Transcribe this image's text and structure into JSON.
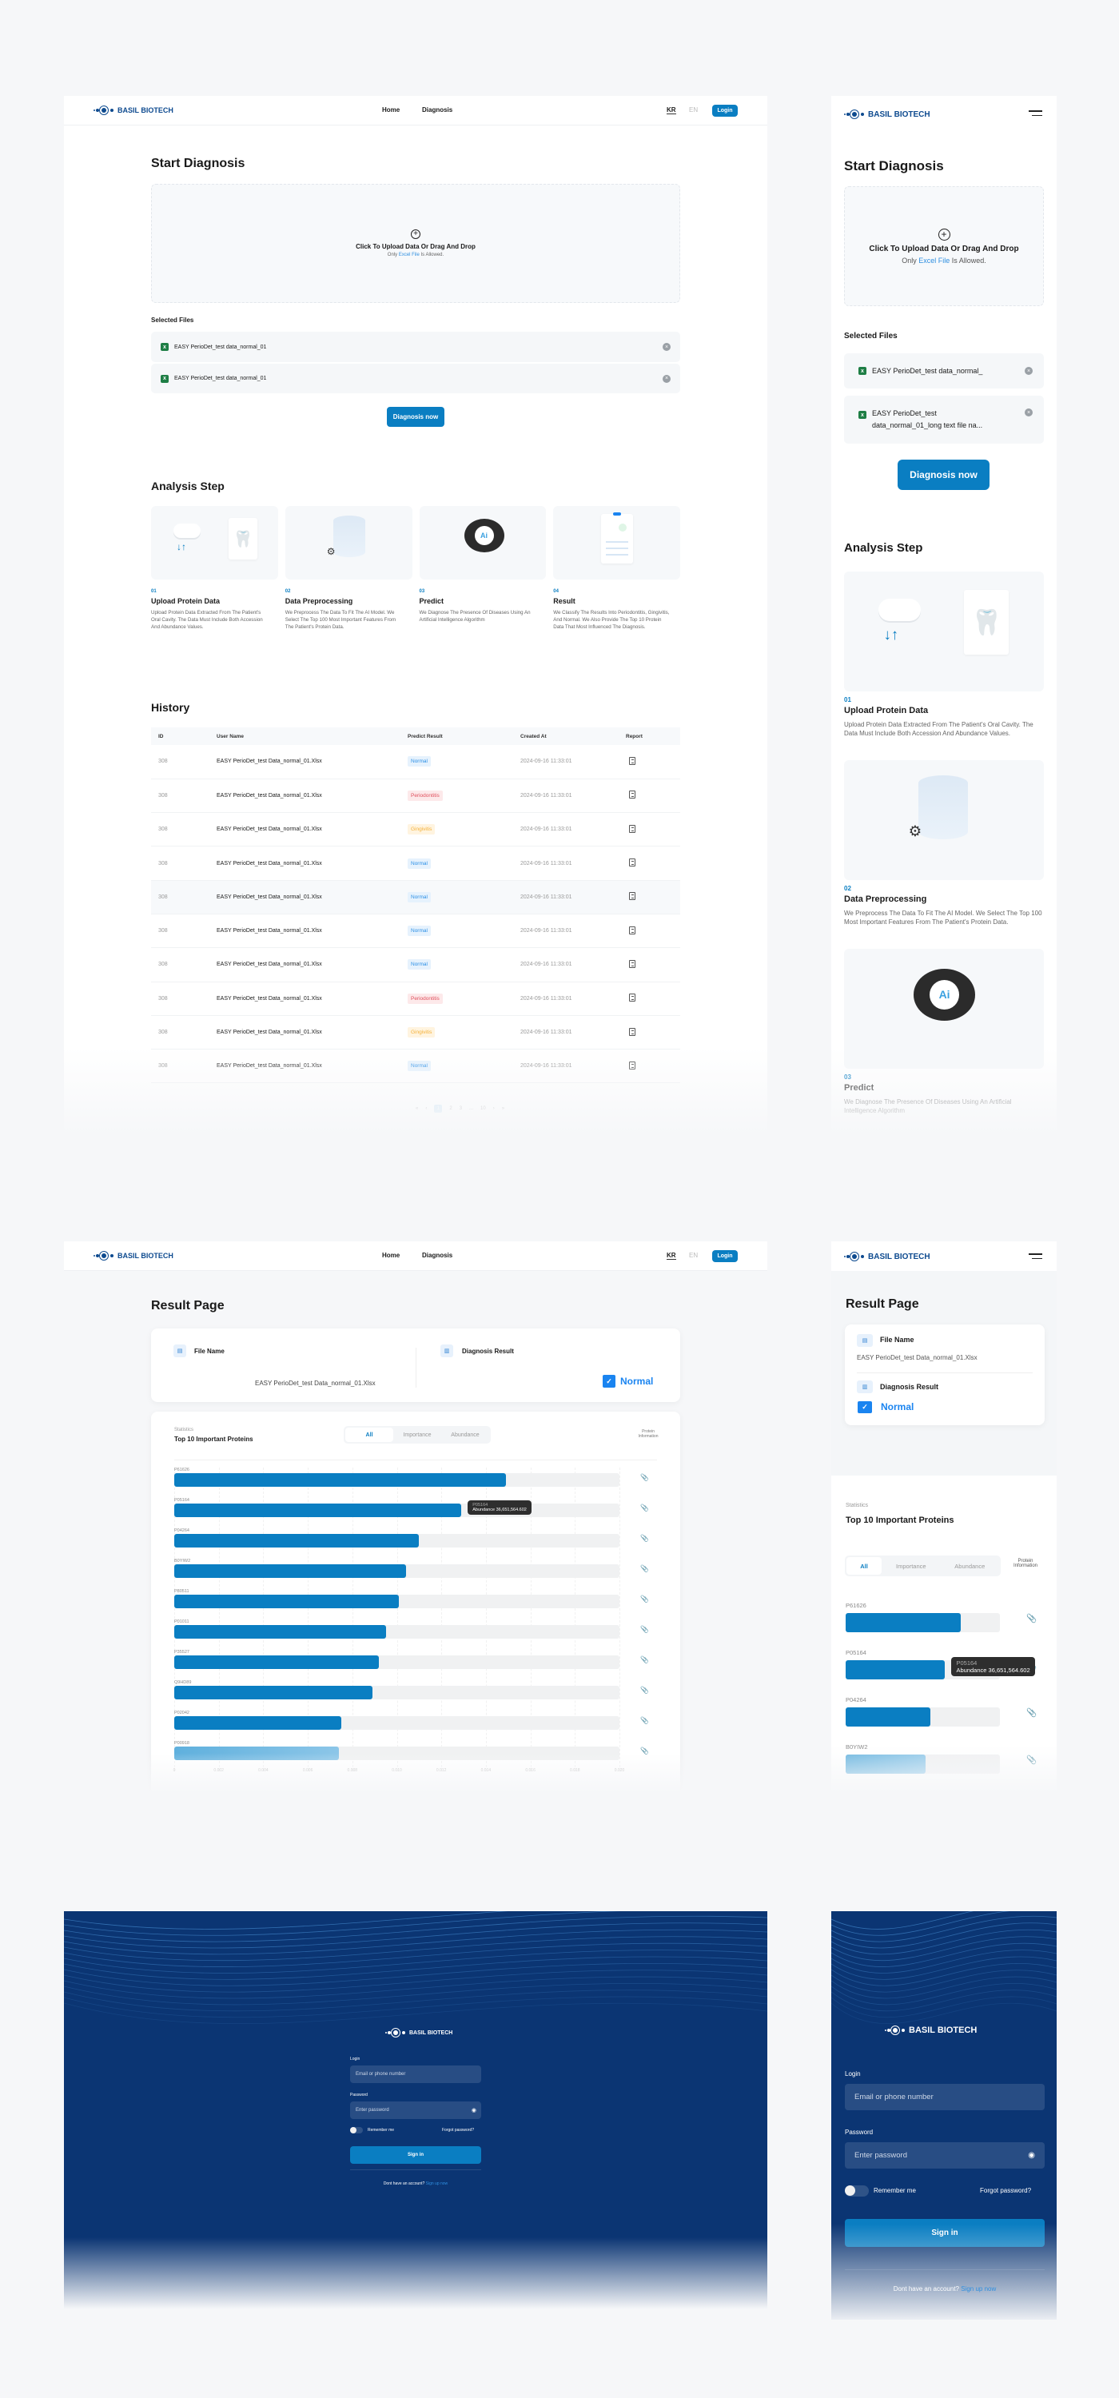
{
  "brand": "BASIL BIOTECH",
  "nav": {
    "home": "Home",
    "diagnosis": "Diagnosis",
    "lang_kr": "KR",
    "lang_en": "EN",
    "login": "Login"
  },
  "colors": {
    "primary": "#0a7ec2",
    "brand": "#0d4a8f",
    "login_bg": "#0b3573",
    "normal": "#2b8fe6",
    "periodontitis": "#e0505d",
    "gingivitis": "#f4b13a"
  },
  "diagnosis": {
    "title": "Start Diagnosis",
    "upload_title": "Click To Upload Data Or Drag And Drop",
    "upload_note_pre": "Only ",
    "upload_note_link": "Excel File",
    "upload_note_post": " Is Allowed.",
    "selected_files_label": "Selected Files",
    "files": [
      "EASY PerioDet_test data_normal_01",
      "EASY PerioDet_test data_normal_01"
    ],
    "mobile_files": [
      "EASY PerioDet_test data_normal_",
      "EASY PerioDet_test data_normal_01_long text file na..."
    ],
    "button": "Diagnosis now"
  },
  "analysis": {
    "title": "Analysis Step",
    "steps": [
      {
        "num": "01",
        "title": "Upload Protein Data",
        "desc": "Upload Protein Data Extracted From The Patient's Oral Cavity. The Data Must Include Both Accession And Abundance Values.",
        "icon": "cloud-upload-tooth-icon"
      },
      {
        "num": "02",
        "title": "Data Preprocessing",
        "desc": "We Preprocess The Data To Fit The AI Model. We Select The Top 100 Most Important Features From The Patient's Protein Data.",
        "icon": "database-gear-icon"
      },
      {
        "num": "03",
        "title": "Predict",
        "desc": "We Diagnose The Presence Of Diseases Using An Artificial Intelligence Algorithm",
        "icon": "ai-eye-icon"
      },
      {
        "num": "04",
        "title": "Result",
        "desc": "We Classify The Results Into Periodontitis, Gingivitis, And Normal. We Also Provide The Top 10 Protein Data That Most Influenced The Diagnosis.",
        "icon": "clipboard-report-icon"
      }
    ]
  },
  "history": {
    "title": "History",
    "columns": [
      "ID",
      "User Name",
      "Predict Result",
      "Created At",
      "Report"
    ],
    "rows": [
      {
        "id": "308",
        "name": "EASY PerioDet_test Data_normal_01.Xlsx",
        "result": "Normal",
        "status": "normal",
        "created": "2024-09-16 11:33:01"
      },
      {
        "id": "308",
        "name": "EASY PerioDet_test Data_normal_01.Xlsx",
        "result": "Periodontitis",
        "status": "perio",
        "created": "2024-09-16 11:33:01"
      },
      {
        "id": "308",
        "name": "EASY PerioDet_test Data_normal_01.Xlsx",
        "result": "Gingivitis",
        "status": "ging",
        "created": "2024-09-16 11:33:01"
      },
      {
        "id": "308",
        "name": "EASY PerioDet_test Data_normal_01.Xlsx",
        "result": "Normal",
        "status": "normal",
        "created": "2024-09-16 11:33:01"
      },
      {
        "id": "308",
        "name": "EASY PerioDet_test Data_normal_01.Xlsx",
        "result": "Normal",
        "status": "normal",
        "created": "2024-09-16 11:33:01"
      },
      {
        "id": "308",
        "name": "EASY PerioDet_test Data_normal_01.Xlsx",
        "result": "Normal",
        "status": "normal",
        "created": "2024-09-16 11:33:01"
      },
      {
        "id": "308",
        "name": "EASY PerioDet_test Data_normal_01.Xlsx",
        "result": "Normal",
        "status": "normal",
        "created": "2024-09-16 11:33:01"
      },
      {
        "id": "308",
        "name": "EASY PerioDet_test Data_normal_01.Xlsx",
        "result": "Periodontitis",
        "status": "perio",
        "created": "2024-09-16 11:33:01"
      },
      {
        "id": "308",
        "name": "EASY PerioDet_test Data_normal_01.Xlsx",
        "result": "Gingivitis",
        "status": "ging",
        "created": "2024-09-16 11:33:01"
      },
      {
        "id": "308",
        "name": "EASY PerioDet_test Data_normal_01.Xlsx",
        "result": "Normal",
        "status": "normal",
        "created": "2024-09-16 11:33:01"
      }
    ],
    "pagination": [
      "«",
      "‹",
      "1",
      "2",
      "3",
      "...",
      "10",
      "›",
      "»"
    ],
    "current_page": "1"
  },
  "result": {
    "title": "Result Page",
    "file_name_label": "File Name",
    "file_name": "EASY PerioDet_test Data_normal_01.Xlsx",
    "diagnosis_label": "Diagnosis Result",
    "diagnosis_value": "Normal",
    "statistics_label": "Statistics",
    "chart_title": "Top 10 Important Proteins",
    "tabs": [
      "All",
      "Importance",
      "Abundance"
    ],
    "active_tab": "All",
    "protein_info_label": "Protein Information",
    "tooltip": {
      "protein": "P05164",
      "text": "Abundance 36,651,564.602"
    }
  },
  "chart_data": {
    "type": "bar",
    "orientation": "horizontal",
    "title": "Top 10 Important Proteins",
    "categories": [
      "P61626",
      "P05164",
      "P04264",
      "B0YIW2",
      "P80511",
      "P01011",
      "P35527",
      "Q9HD89",
      "P02042",
      "P00918"
    ],
    "values": [
      0.0149,
      0.0129,
      0.011,
      0.0104,
      0.0101,
      0.0095,
      0.0092,
      0.0089,
      0.0075,
      0.0074
    ],
    "xlim": [
      0,
      0.02
    ],
    "xticks": [
      "0",
      "0.002",
      "0.004",
      "0.006",
      "0.008",
      "0.010",
      "0.012",
      "0.014",
      "0.016",
      "0.018",
      "0.020"
    ],
    "grid": true
  },
  "login": {
    "login_label": "Login",
    "login_placeholder": "Email or phone number",
    "password_label": "Password",
    "password_placeholder": "Enter password",
    "remember": "Remember me",
    "remember_on": false,
    "forgot": "Forgot password?",
    "sign_in": "Sign in",
    "no_account": "Dont have an account?",
    "sign_up": "Sign up now"
  }
}
